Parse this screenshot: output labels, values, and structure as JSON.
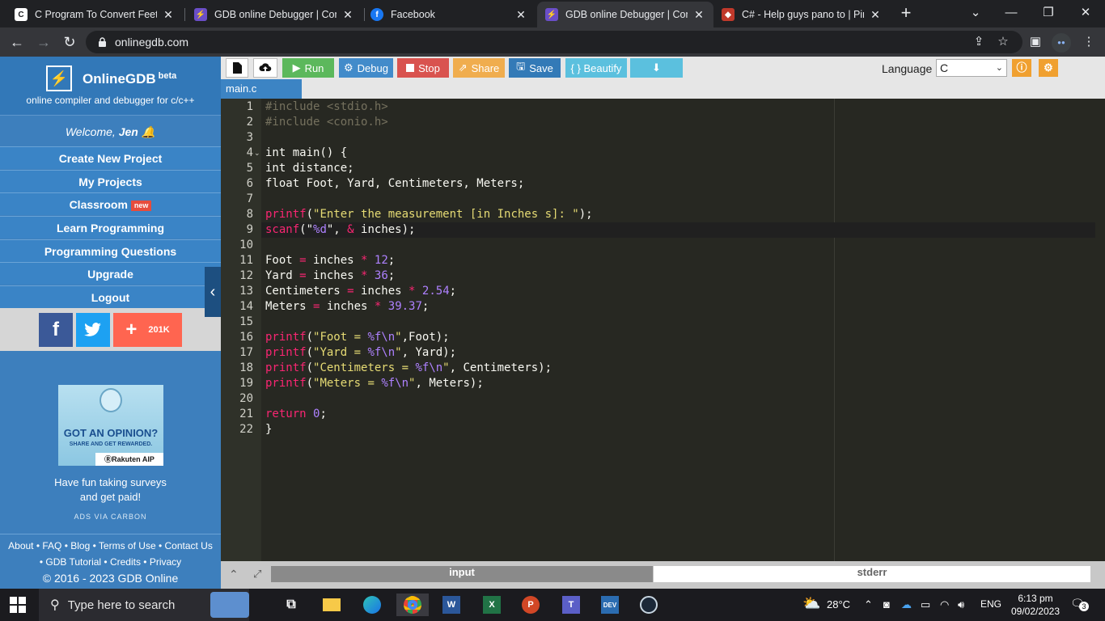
{
  "browser": {
    "tabs": [
      {
        "title": "C Program To Convert Feet, Y",
        "favicon": "C",
        "color": "#ffffff",
        "fg": "#202124"
      },
      {
        "title": "GDB online Debugger | Comp",
        "favicon": "⚡",
        "color": "#6a4ec8",
        "fg": "#ffffff"
      },
      {
        "title": "Facebook",
        "favicon": "f",
        "color": "#1877f2",
        "fg": "#ffffff"
      },
      {
        "title": "GDB online Debugger | Comp",
        "favicon": "⚡",
        "color": "#6a4ec8",
        "fg": "#ffffff"
      },
      {
        "title": "C# - Help guys pano to | Pino",
        "favicon": "◆",
        "color": "#c0392b",
        "fg": "#ffffff"
      }
    ],
    "url": "onlinegdb.com"
  },
  "sidebar": {
    "brand": "OnlineGDB",
    "beta": "beta",
    "tagline": "online compiler and debugger for c/c++",
    "welcome_prefix": "Welcome, ",
    "welcome_user": "Jen",
    "menu": [
      {
        "label": "Create New Project"
      },
      {
        "label": "My Projects"
      },
      {
        "label": "Classroom",
        "badge": "new"
      },
      {
        "label": "Learn Programming"
      },
      {
        "label": "Programming Questions"
      },
      {
        "label": "Upgrade"
      },
      {
        "label": "Logout"
      }
    ],
    "share_count": "201K",
    "ad": {
      "headline": "GOT AN OPINION?",
      "subline": "SHARE AND GET REWARDED.",
      "sponsor": "ⓇRakuten AIP",
      "text_line1": "Have fun taking surveys",
      "text_line2": "and get paid!",
      "via": "ADS VIA CARBON"
    },
    "footer": {
      "line1": "About • FAQ • Blog • Terms of Use • Contact Us",
      "line2": "• GDB Tutorial • Credits • Privacy",
      "line3": "© 2016 - 2023 GDB Online"
    }
  },
  "toolbar": {
    "run": "Run",
    "debug": "Debug",
    "stop": "Stop",
    "share": "Share",
    "save": "Save",
    "beautify": "{ } Beautify",
    "language_label": "Language",
    "language_value": "C",
    "colors": {
      "run": "#5cb85c",
      "debug": "#428bca",
      "stop": "#d9534f",
      "share": "#f0ad4e",
      "save": "#337ab7",
      "beautify": "#5bc0de",
      "download": "#5bc0de"
    }
  },
  "editor": {
    "filename": "main.c",
    "highlight_line": 9,
    "lines": [
      [
        {
          "t": "#include <stdio.h>",
          "c": "cmt"
        }
      ],
      [
        {
          "t": "#include <conio.h>",
          "c": "cmt"
        }
      ],
      [],
      [
        {
          "t": "int main() {"
        }
      ],
      [
        {
          "t": "int distance;"
        }
      ],
      [
        {
          "t": "float Foot, Yard, Centimeters, Meters;"
        }
      ],
      [],
      [
        {
          "t": "printf",
          "c": "kw"
        },
        {
          "t": "("
        },
        {
          "t": "\"Enter the measurement [in Inches s]: \"",
          "c": "str"
        },
        {
          "t": ");"
        }
      ],
      [
        {
          "t": "scanf",
          "c": "kw"
        },
        {
          "t": "(\""
        },
        {
          "t": "%d",
          "c": "num"
        },
        {
          "t": "\", "
        },
        {
          "t": "&",
          "c": "kw"
        },
        {
          "t": " inches);"
        }
      ],
      [],
      [
        {
          "t": "Foot "
        },
        {
          "t": "=",
          "c": "kw"
        },
        {
          "t": " inches "
        },
        {
          "t": "*",
          "c": "kw"
        },
        {
          "t": " "
        },
        {
          "t": "12",
          "c": "num"
        },
        {
          "t": ";"
        }
      ],
      [
        {
          "t": "Yard "
        },
        {
          "t": "=",
          "c": "kw"
        },
        {
          "t": " inches "
        },
        {
          "t": "*",
          "c": "kw"
        },
        {
          "t": " "
        },
        {
          "t": "36",
          "c": "num"
        },
        {
          "t": ";"
        }
      ],
      [
        {
          "t": "Centimeters "
        },
        {
          "t": "=",
          "c": "kw"
        },
        {
          "t": " inches "
        },
        {
          "t": "*",
          "c": "kw"
        },
        {
          "t": " "
        },
        {
          "t": "2.54",
          "c": "num"
        },
        {
          "t": ";"
        }
      ],
      [
        {
          "t": "Meters "
        },
        {
          "t": "=",
          "c": "kw"
        },
        {
          "t": " inches "
        },
        {
          "t": "*",
          "c": "kw"
        },
        {
          "t": " "
        },
        {
          "t": "39.37",
          "c": "num"
        },
        {
          "t": ";"
        }
      ],
      [],
      [
        {
          "t": "printf",
          "c": "kw"
        },
        {
          "t": "("
        },
        {
          "t": "\"Foot = ",
          "c": "str"
        },
        {
          "t": "%f\\n",
          "c": "num"
        },
        {
          "t": "\"",
          "c": "str"
        },
        {
          "t": ",Foot);"
        }
      ],
      [
        {
          "t": "printf",
          "c": "kw"
        },
        {
          "t": "("
        },
        {
          "t": "\"Yard = ",
          "c": "str"
        },
        {
          "t": "%f\\n",
          "c": "num"
        },
        {
          "t": "\"",
          "c": "str"
        },
        {
          "t": ", Yard);"
        }
      ],
      [
        {
          "t": "printf",
          "c": "kw"
        },
        {
          "t": "("
        },
        {
          "t": "\"Centimeters = ",
          "c": "str"
        },
        {
          "t": "%f\\n",
          "c": "num"
        },
        {
          "t": "\"",
          "c": "str"
        },
        {
          "t": ", Centimeters);"
        }
      ],
      [
        {
          "t": "printf",
          "c": "kw"
        },
        {
          "t": "("
        },
        {
          "t": "\"Meters = ",
          "c": "str"
        },
        {
          "t": "%f\\n",
          "c": "num"
        },
        {
          "t": "\"",
          "c": "str"
        },
        {
          "t": ", Meters);"
        }
      ],
      [],
      [
        {
          "t": "return",
          "c": "kw"
        },
        {
          "t": " "
        },
        {
          "t": "0",
          "c": "num"
        },
        {
          "t": ";"
        }
      ],
      [
        {
          "t": "}"
        }
      ]
    ]
  },
  "bottom": {
    "input_tab": "input",
    "stderr_tab": "stderr"
  },
  "taskbar": {
    "search_placeholder": "Type here to search",
    "weather": "28°C",
    "lang": "ENG",
    "time": "6:13 pm",
    "date": "09/02/2023",
    "notifications": "3"
  }
}
